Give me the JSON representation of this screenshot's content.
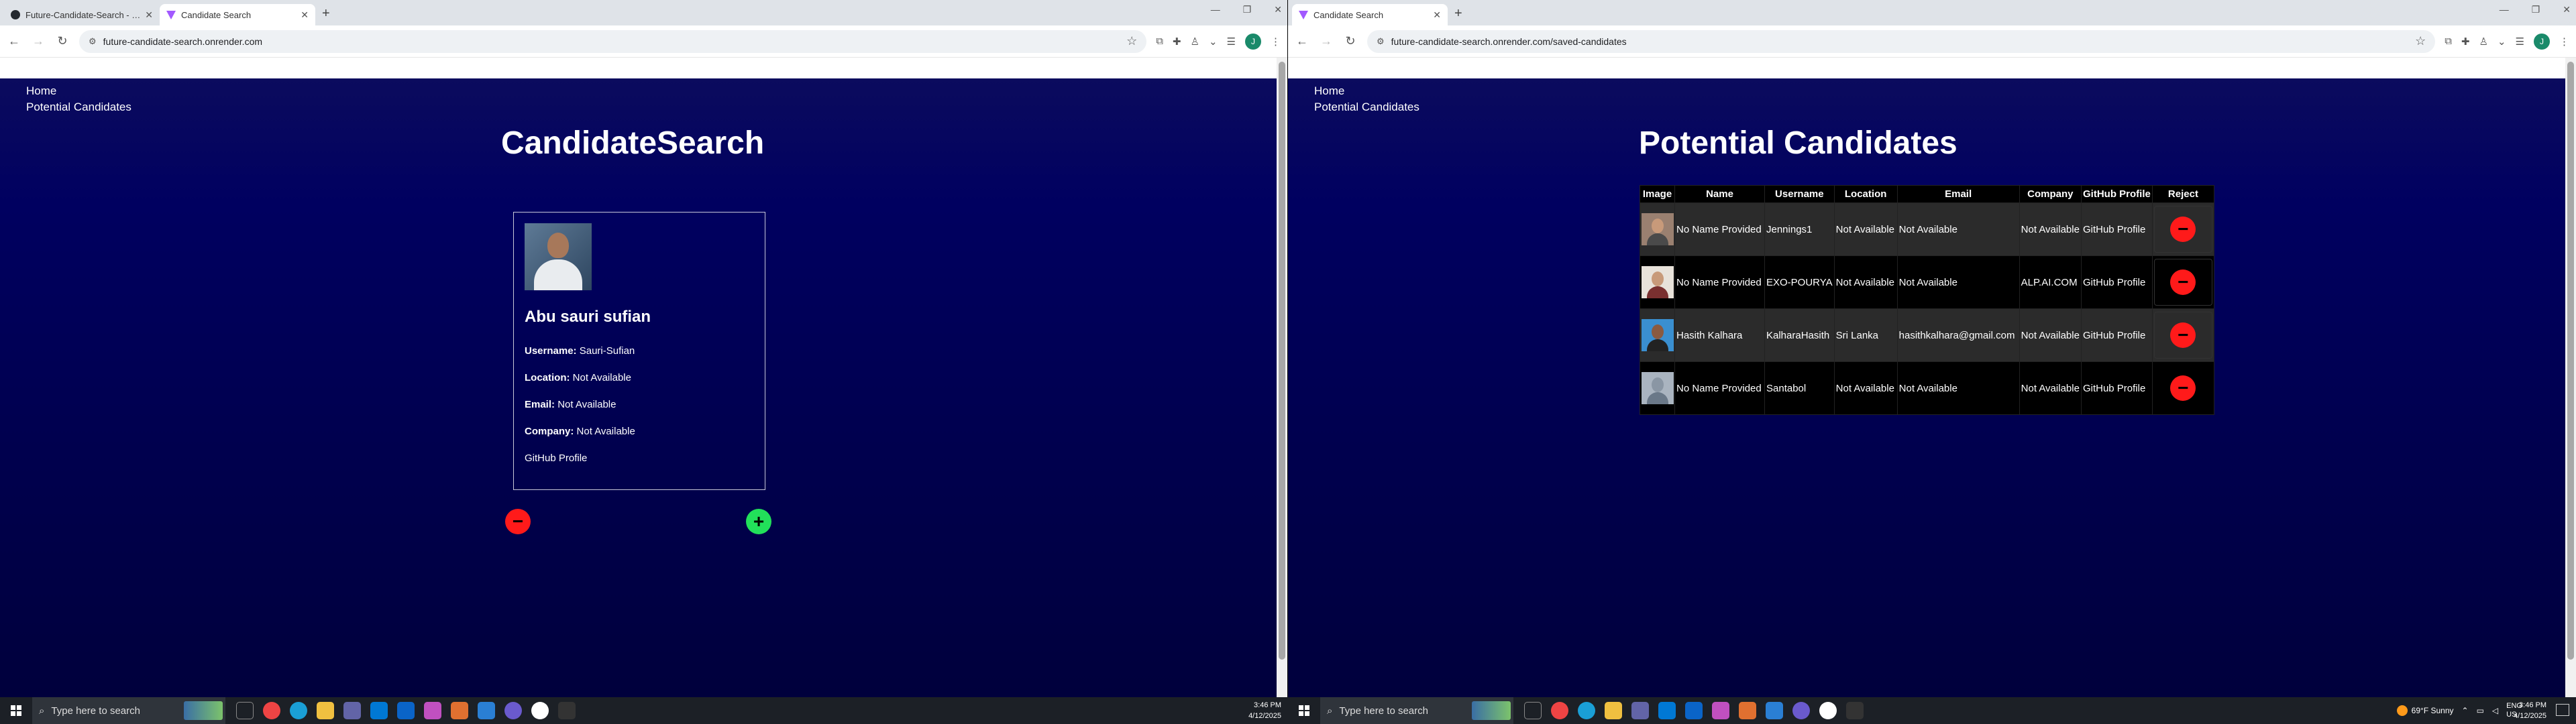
{
  "left_window": {
    "tabs": [
      {
        "title": "Future-Candidate-Search - Sta",
        "active": false,
        "favicon": "github-icon"
      },
      {
        "title": "Candidate Search",
        "active": true,
        "favicon": "vite-icon"
      }
    ],
    "url": "future-candidate-search.onrender.com",
    "profile_initial": "J",
    "nav": {
      "home": "Home",
      "potential": "Potential Candidates"
    },
    "heading": "CandidateSearch",
    "candidate": {
      "name": "Abu sauri sufian",
      "username_label": "Username:",
      "username": "Sauri-Sufian",
      "location_label": "Location:",
      "location": "Not Available",
      "email_label": "Email:",
      "email": "Not Available",
      "company_label": "Company:",
      "company": "Not Available",
      "github": "GitHub Profile"
    },
    "reject_symbol": "−",
    "accept_symbol": "+"
  },
  "right_window": {
    "tabs": [
      {
        "title": "Candidate Search",
        "active": true,
        "favicon": "vite-icon"
      }
    ],
    "url": "future-candidate-search.onrender.com/saved-candidates",
    "profile_initial": "J",
    "nav": {
      "home": "Home",
      "potential": "Potential Candidates"
    },
    "heading": "Potential Candidates",
    "table": {
      "headers": [
        "Image",
        "Name",
        "Username",
        "Location",
        "Email",
        "Company",
        "GitHub Profile",
        "Reject"
      ],
      "rows": [
        {
          "name": "No Name Provided",
          "username": "Jennings1",
          "location": "Not Available",
          "email": "Not Available",
          "company": "Not Available",
          "github": "GitHub Profile"
        },
        {
          "name": "No Name Provided",
          "username": "EXO-POURYA",
          "location": "Not Available",
          "email": "Not Available",
          "company": "ALP.AI.COM",
          "github": "GitHub Profile"
        },
        {
          "name": "Hasith Kalhara",
          "username": "KalharaHasith",
          "location": "Sri Lanka",
          "email": "hasithkalhara@gmail.com",
          "company": "Not Available",
          "github": "GitHub Profile"
        },
        {
          "name": "No Name Provided",
          "username": "Santabol",
          "location": "Not Available",
          "email": "Not Available",
          "company": "Not Available",
          "github": "GitHub Profile"
        }
      ],
      "reject_symbol": "−"
    }
  },
  "taskbar": {
    "search_placeholder": "Type here to search",
    "left_time": "3:46 PM",
    "left_date": "4/12/2025",
    "weather": "69°F  Sunny",
    "lang": "ENG",
    "region": "US",
    "right_time": "3:46 PM",
    "right_date": "4/12/2025"
  },
  "colors": {
    "page_bg": "#000060",
    "reject": "#ff1a1a",
    "accept": "#22e05a"
  }
}
